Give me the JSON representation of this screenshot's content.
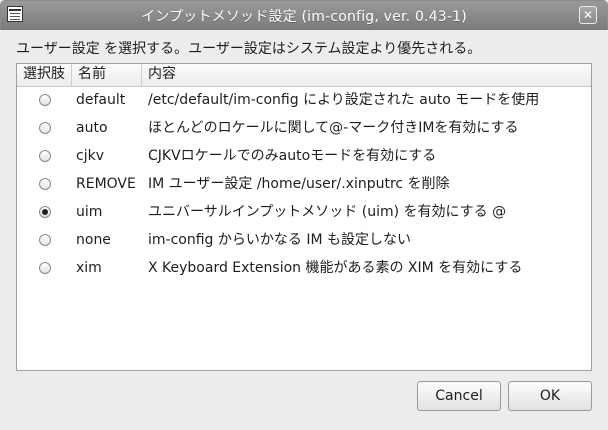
{
  "window": {
    "title": "インプットメソッド設定 (im-config, ver. 0.43-1)",
    "icon": "window-menu-icon",
    "close_glyph": "✕"
  },
  "instruction": "ユーザー設定 を選択する。ユーザー設定はシステム設定より優先される。",
  "columns": [
    "選択肢",
    "名前",
    "内容"
  ],
  "rows": [
    {
      "name": "default",
      "description": "/etc/default/im-config により設定された auto モードを使用",
      "selected": false
    },
    {
      "name": "auto",
      "description": "ほとんどのロケールに関して@-マーク付きIMを有効にする",
      "selected": false
    },
    {
      "name": "cjkv",
      "description": "CJKVロケールでのみautoモードを有効にする",
      "selected": false
    },
    {
      "name": "REMOVE",
      "description": "IM ユーザー設定 /home/user/.xinputrc を削除",
      "selected": false
    },
    {
      "name": "uim",
      "description": "ユニバーサルインプットメソッド (uim) を有効にする @",
      "selected": true
    },
    {
      "name": "none",
      "description": "im-config からいかなる IM も設定しない",
      "selected": false
    },
    {
      "name": "xim",
      "description": "X Keyboard Extension 機能がある素の XIM を有効にする",
      "selected": false
    }
  ],
  "buttons": {
    "cancel": "Cancel",
    "ok": "OK"
  }
}
